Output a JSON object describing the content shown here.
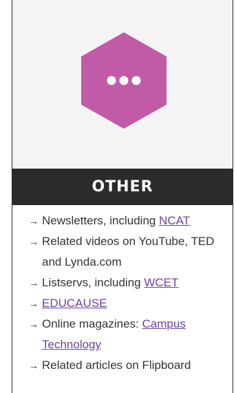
{
  "icon": {
    "name": "more-dots-icon",
    "color": "#c15ba8"
  },
  "section": {
    "title": "OTHER"
  },
  "items": [
    {
      "text": "Newsletters, including ",
      "link": "NCAT"
    },
    {
      "text": "Related videos on YouTube, TED and Lynda.com",
      "link": ""
    },
    {
      "text": "Listservs, including ",
      "link": "WCET"
    },
    {
      "text": "",
      "link": "EDUCAUSE"
    },
    {
      "text": "Online magazines: ",
      "link": "Campus Technology"
    },
    {
      "text": "Related articles on Flipboard",
      "link": ""
    }
  ],
  "arrow_glyph": "→"
}
